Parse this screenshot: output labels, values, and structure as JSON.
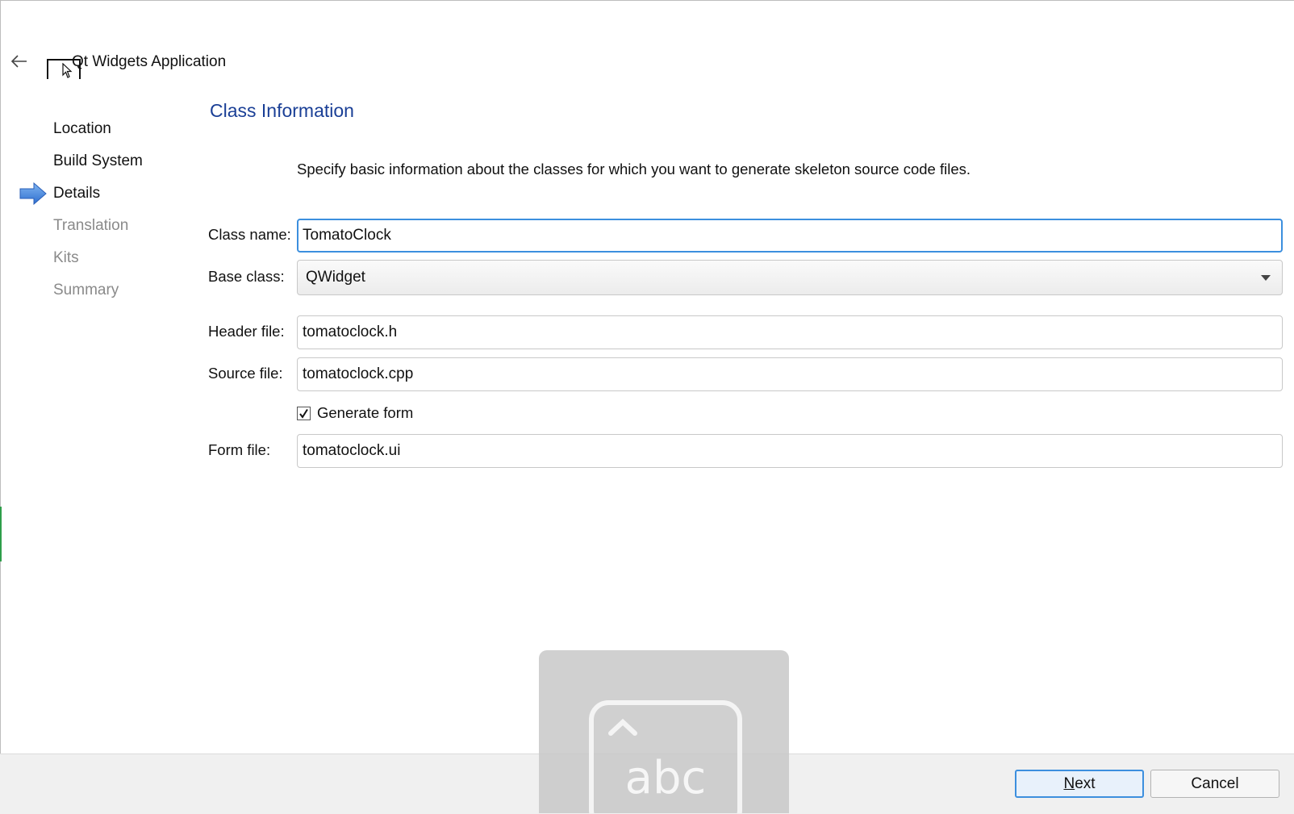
{
  "wizard": {
    "title": "Qt Widgets Application"
  },
  "steps": [
    {
      "label": "Location",
      "state": "done"
    },
    {
      "label": "Build System",
      "state": "done"
    },
    {
      "label": "Details",
      "state": "current"
    },
    {
      "label": "Translation",
      "state": "pending"
    },
    {
      "label": "Kits",
      "state": "pending"
    },
    {
      "label": "Summary",
      "state": "pending"
    }
  ],
  "page": {
    "title": "Class Information",
    "description": "Specify basic information about the classes for which you want to generate skeleton source code files."
  },
  "form": {
    "class_name": {
      "label": "Class name:",
      "value": "TomatoClock"
    },
    "base_class": {
      "label": "Base class:",
      "value": "QWidget"
    },
    "header_file": {
      "label": "Header file:",
      "value": "tomatoclock.h"
    },
    "source_file": {
      "label": "Source file:",
      "value": "tomatoclock.cpp"
    },
    "generate_form": {
      "label": "Generate form",
      "checked": true
    },
    "form_file": {
      "label": "Form file:",
      "value": "tomatoclock.ui"
    }
  },
  "buttons": {
    "next_underlined": "N",
    "next_rest": "ext",
    "cancel": "Cancel"
  },
  "keyboard_overlay": {
    "text": "abc",
    "icon": "keyboard-caret-up-icon"
  },
  "colors": {
    "title_blue": "#1a3f96",
    "focus_blue": "#3c8fde",
    "step_arrow": "#3c7fd8"
  }
}
